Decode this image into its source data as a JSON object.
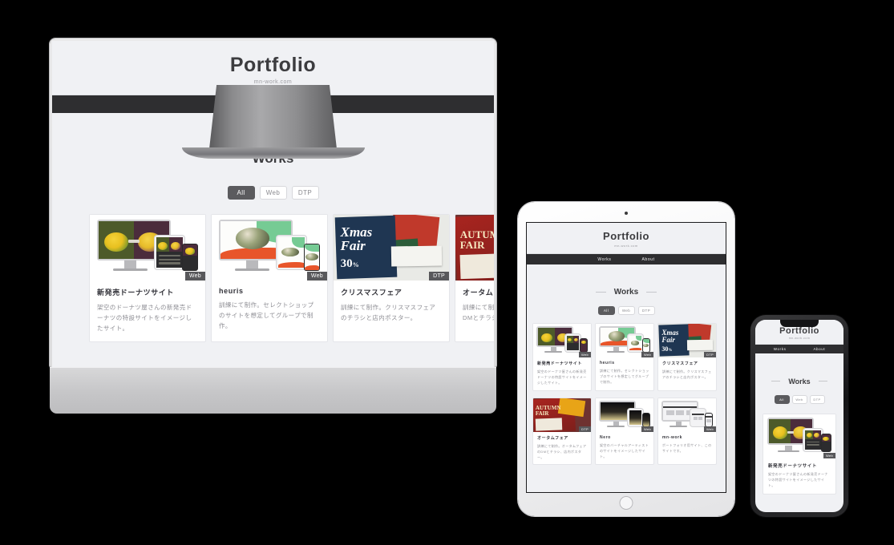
{
  "site": {
    "brand_title": "Portfolio",
    "brand_sub": "mn-work.com",
    "nav": [
      {
        "label": "Works"
      },
      {
        "label": "About"
      }
    ],
    "section_title": "Works",
    "filters": [
      {
        "label": "All",
        "active": true
      },
      {
        "label": "Web",
        "active": false
      },
      {
        "label": "DTP",
        "active": false
      }
    ],
    "works": [
      {
        "title": "新発売ドーナツサイト",
        "desc": "架空のドーナツ屋さんの新発売ドーナツの特設サイトをイメージしたサイト。",
        "badge": "Web"
      },
      {
        "title": "heuris",
        "desc": "訓練にて制作。セレクトショップのサイトを想定してグループで制作。",
        "badge": "Web"
      },
      {
        "title": "クリスマスフェア",
        "desc": "訓練にて制作。クリスマスフェアのチラシと店内ポスター。",
        "badge": "DTP"
      },
      {
        "title": "オータムフェア",
        "desc": "訓練にて制作。オータムフェアのDMとチラシ、店内ポスター。",
        "badge": "DTP"
      },
      {
        "title": "Nero",
        "desc": "架空のバーチャルアーティストのサイトをイメージしたサイト。",
        "badge": "Web"
      },
      {
        "title": "mn-work",
        "desc": "ポートフォリオ用サイト、このサイトです。",
        "badge": "Web"
      }
    ]
  },
  "devices": {
    "desktop": {
      "name": "iMac desktop mockup"
    },
    "tablet": {
      "name": "iPad tablet mockup"
    },
    "phone": {
      "name": "iPhone mobile mockup"
    }
  },
  "colors": {
    "page_bg": "#f0f1f4",
    "nav_bg": "#2e2e30",
    "text_dark": "#3c3c3f",
    "text_muted": "#8e8e94",
    "badge_bg": "#58585b",
    "filter_active_bg": "#5b5b5e",
    "card_bg": "#ffffff",
    "backdrop": "#000000"
  }
}
